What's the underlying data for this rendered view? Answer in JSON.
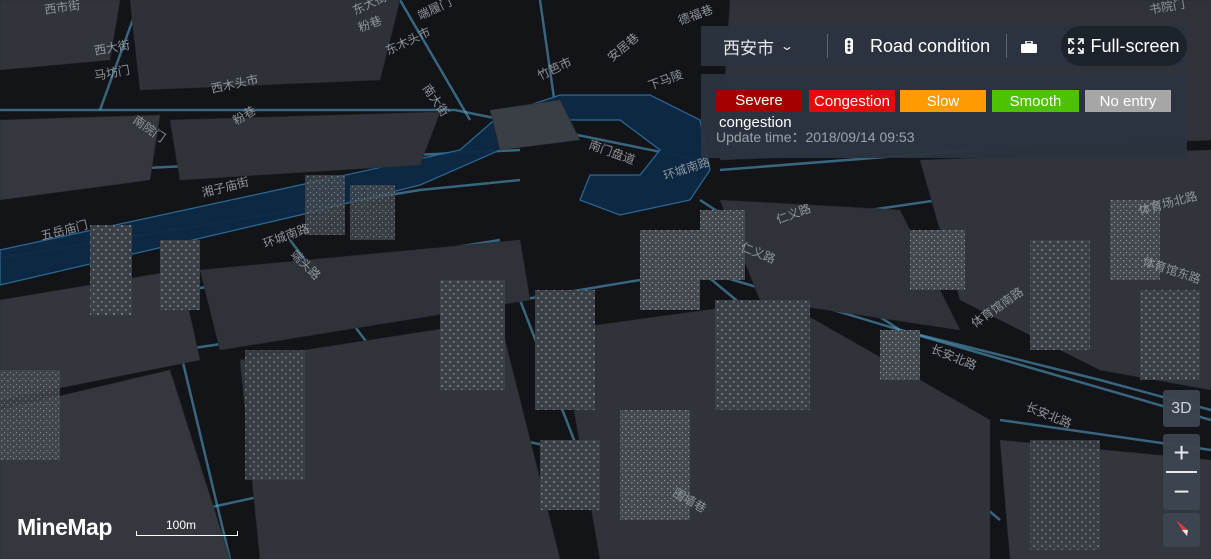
{
  "toolbar": {
    "city": "西安市",
    "road_condition": "Road condition",
    "fullscreen": "Full-screen"
  },
  "legend": {
    "items": [
      {
        "label": "Severe",
        "label_line2": "congestion",
        "color": "#a40000"
      },
      {
        "label": "Congestion",
        "color": "#e60b0b"
      },
      {
        "label": "Slow",
        "color": "#ff9a00"
      },
      {
        "label": "Smooth",
        "color": "#4ec200"
      },
      {
        "label": "No entry",
        "color": "#a6a6a6"
      }
    ],
    "update_time": "Update time：2018/09/14 09:53"
  },
  "controls": {
    "mode_3d": "3D",
    "zoom_in": "+",
    "zoom_out": "−",
    "compass_icon": "compass-icon"
  },
  "branding": {
    "logo": "MineMap",
    "scale": "100m"
  },
  "map_labels": [
    "西市街",
    "西大街",
    "马坊门",
    "西木头市",
    "南院门",
    "粉巷",
    "湘子庙街",
    "五岳庙门",
    "环城南路",
    "端头路",
    "南门盘道",
    "环城南路",
    "仁义路",
    "仁义路",
    "体育馆南路",
    "长安北路",
    "长安北路",
    "围墙巷",
    "东木头市",
    "南大街",
    "粉巷",
    "竹笆市",
    "东大街",
    "端履门",
    "体育馆东路",
    "体育场北路",
    "安居巷",
    "下马陵",
    "德福巷",
    "书院门"
  ],
  "colors": {
    "map_background": "#15181d",
    "road": "#5aa9d6",
    "moat": "#0d2a44",
    "building": "#3a3f45"
  }
}
